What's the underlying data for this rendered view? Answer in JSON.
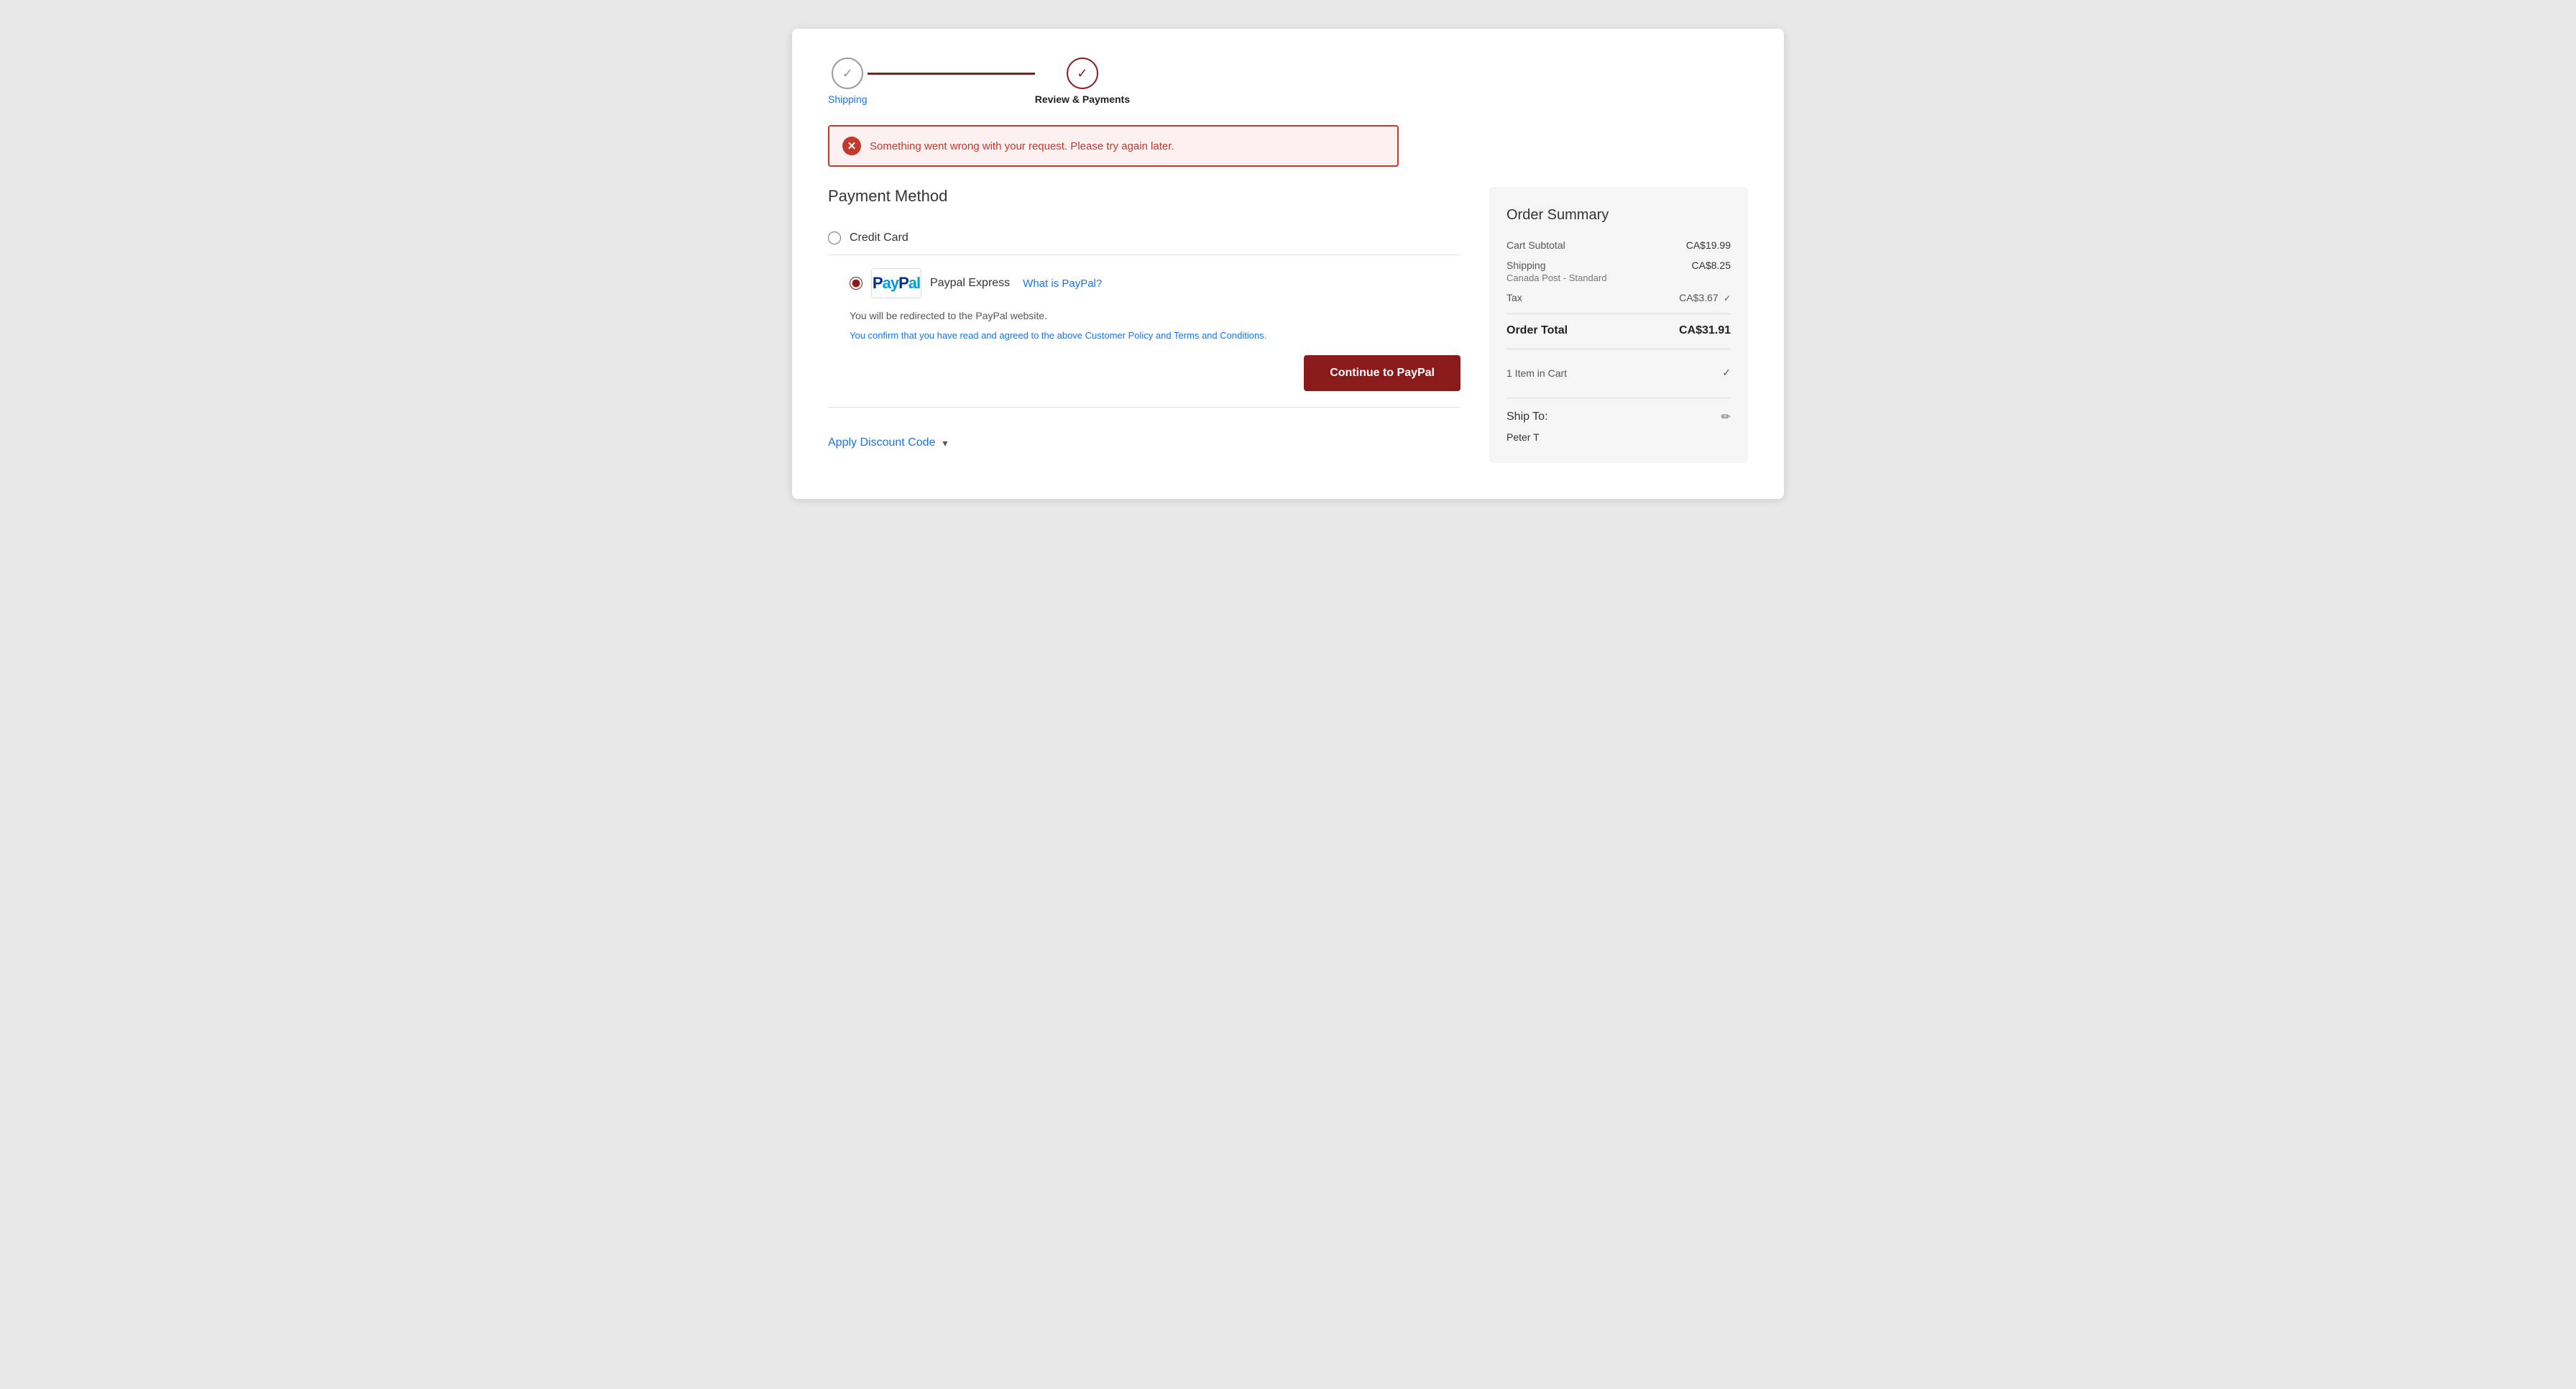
{
  "stepper": {
    "steps": [
      {
        "id": "shipping",
        "label": "Shipping",
        "state": "done"
      },
      {
        "id": "review",
        "label": "Review & Payments",
        "state": "active"
      }
    ]
  },
  "error": {
    "message": "Something went wrong with your request. Please try again later."
  },
  "payment": {
    "section_title": "Payment Method",
    "options": [
      {
        "id": "credit_card",
        "label": "Credit Card",
        "selected": false
      },
      {
        "id": "paypal",
        "label": "Paypal Express",
        "selected": true
      }
    ],
    "paypal": {
      "what_is_link": "What is PayPal?",
      "redirect_text": "You will be redirected to the PayPal website.",
      "terms_text": "You confirm that you have read and agreed to the above Customer Policy and Terms and Conditions.",
      "continue_button": "Continue to PayPal"
    },
    "discount": {
      "label": "Apply Discount Code"
    }
  },
  "order_summary": {
    "title": "Order Summary",
    "cart_subtotal_label": "Cart Subtotal",
    "cart_subtotal_value": "CA$19.99",
    "shipping_label": "Shipping",
    "shipping_value": "CA$8.25",
    "shipping_detail": "Canada Post - Standard",
    "tax_label": "Tax",
    "tax_value": "CA$3.67",
    "order_total_label": "Order Total",
    "order_total_value": "CA$31.91",
    "items_in_cart": "1 Item in Cart",
    "ship_to_label": "Ship To:",
    "customer_name": "Peter T",
    "edit_icon_label": "✏"
  },
  "colors": {
    "primary": "#8b1a1a",
    "link": "#1a73e8",
    "error": "#c0392b"
  }
}
